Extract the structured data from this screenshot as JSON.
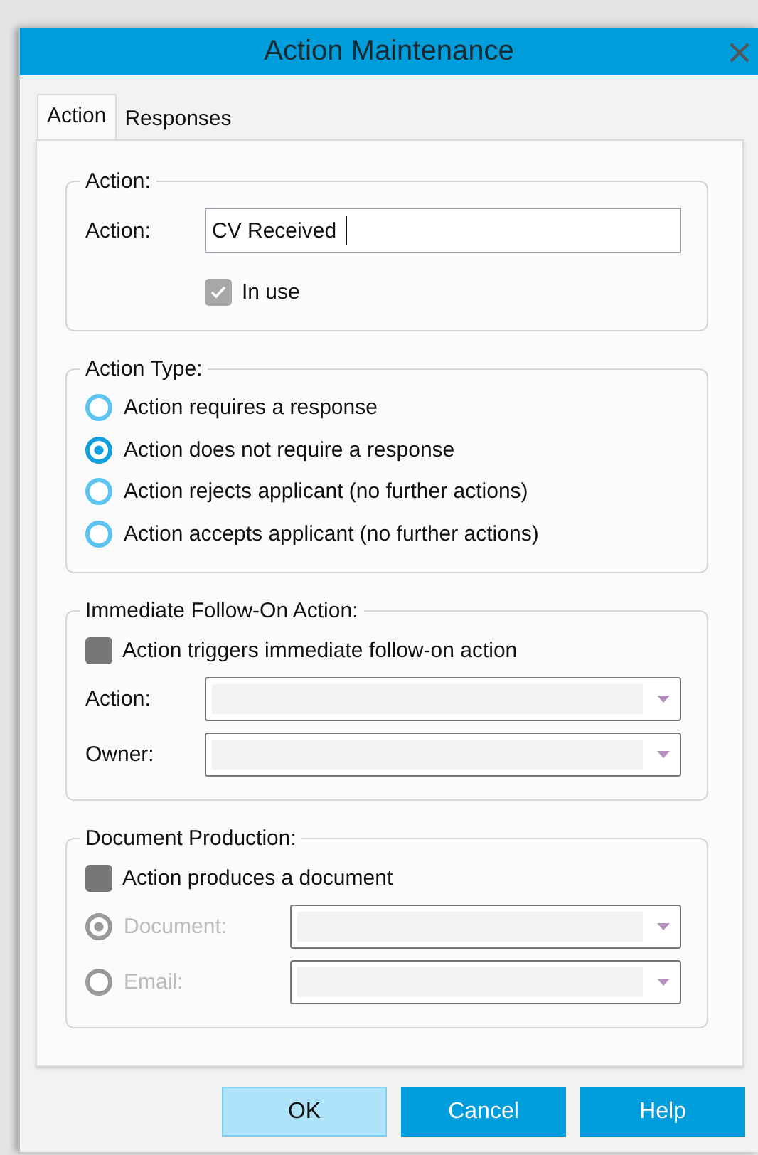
{
  "window": {
    "title": "Action Maintenance"
  },
  "tabs": [
    {
      "label": "Action",
      "selected": true
    },
    {
      "label": "Responses",
      "selected": false
    }
  ],
  "groups": [
    {
      "title": "Action:",
      "rows": [
        {
          "kind": "text_field",
          "label": "Action:",
          "value": "CV Received"
        },
        {
          "kind": "checkbox",
          "label": "In use",
          "checked": true,
          "disabled": true
        }
      ]
    },
    {
      "title": "Action Type:",
      "rows": [
        {
          "kind": "radio",
          "label": "Action requires a response",
          "selected": false,
          "disabled": false
        },
        {
          "kind": "radio",
          "label": "Action does not require a response",
          "selected": true,
          "disabled": false
        },
        {
          "kind": "radio",
          "label": "Action rejects applicant (no further actions)",
          "selected": false,
          "disabled": false
        },
        {
          "kind": "radio",
          "label": "Action accepts applicant (no further actions)",
          "selected": false,
          "disabled": false
        }
      ]
    },
    {
      "title": "Immediate Follow-On Action:",
      "rows": [
        {
          "kind": "checkbox",
          "label": "Action triggers immediate follow-on action",
          "checked": false,
          "disabled": false
        },
        {
          "kind": "combo",
          "label": "Action:"
        },
        {
          "kind": "combo",
          "label": "Owner:"
        }
      ]
    },
    {
      "title": "Document Production:",
      "rows": [
        {
          "kind": "checkbox",
          "label": "Action produces a document",
          "checked": false,
          "disabled": false
        },
        {
          "kind": "radio_combo",
          "label": "Document:",
          "selected": true,
          "disabled": true
        },
        {
          "kind": "radio_combo",
          "label": "Email:",
          "selected": false,
          "disabled": true
        }
      ]
    }
  ],
  "buttons": [
    {
      "label": "OK",
      "focused": true
    },
    {
      "label": "Cancel",
      "focused": false
    },
    {
      "label": "Help",
      "focused": false
    }
  ]
}
